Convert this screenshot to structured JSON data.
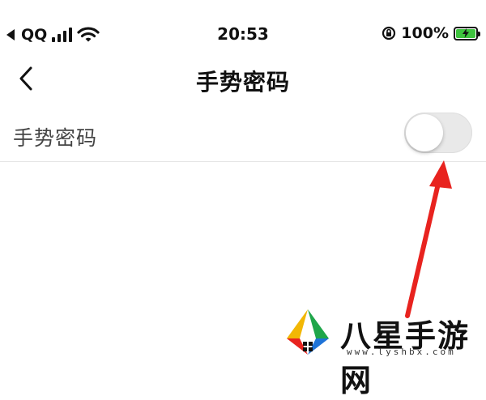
{
  "status_bar": {
    "carrier": "QQ",
    "time": "20:53",
    "battery_percent": "100%",
    "battery_level": 1.0,
    "battery_color": "#3ec33e"
  },
  "nav": {
    "title": "手势密码"
  },
  "settings": {
    "gesture_password_label": "手势密码",
    "gesture_password_enabled": false
  },
  "annotation": {
    "arrow_color": "#e8231f"
  },
  "watermark": {
    "brand": "八星手游网",
    "url": "www.lyshbx.com"
  }
}
